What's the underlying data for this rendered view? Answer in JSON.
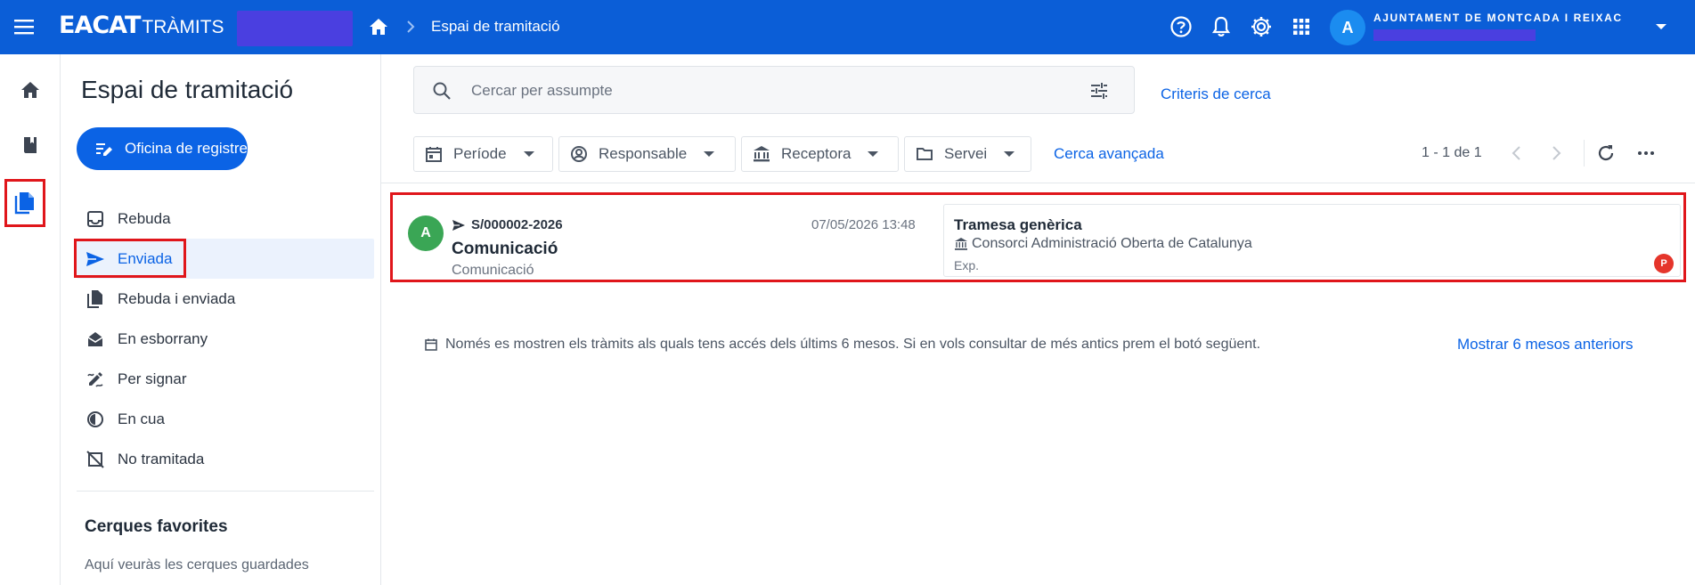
{
  "header": {
    "brand": "EACAT",
    "brand_sub": "TRÀMITS",
    "breadcrumb": "Espai de tramitació",
    "avatar_initial": "A",
    "organization": "AJUNTAMENT DE MONTCADA I REIXAC",
    "icons": [
      "menu-icon",
      "home-icon",
      "help-icon",
      "bell-icon",
      "gear-icon",
      "apps-grid-icon",
      "chevron-down-icon"
    ]
  },
  "rail": {
    "icons": [
      "home-icon",
      "book-icon",
      "documents-icon"
    ]
  },
  "sidebar": {
    "title": "Espai de tramitació",
    "primary_button": "Oficina de registre",
    "items": [
      {
        "label": "Rebuda",
        "icon": "inbox-icon"
      },
      {
        "label": "Enviada",
        "icon": "send-icon"
      },
      {
        "label": "Rebuda i enviada",
        "icon": "copy-icon"
      },
      {
        "label": "En esborrany",
        "icon": "draft-envelope-icon"
      },
      {
        "label": "Per signar",
        "icon": "signature-icon"
      },
      {
        "label": "En cua",
        "icon": "queue-clock-icon"
      },
      {
        "label": "No tramitada",
        "icon": "not-processed-icon"
      }
    ],
    "selected_index": 1,
    "favorites_title": "Cerques favorites",
    "favorites_text": "Aquí veuràs les cerques guardades"
  },
  "search": {
    "placeholder": "Cercar per assumpte",
    "value": "",
    "criteria_link": "Criteris de cerca"
  },
  "filters": [
    {
      "label": "Període",
      "icon": "calendar-icon"
    },
    {
      "label": "Responsable",
      "icon": "user-circle-icon"
    },
    {
      "label": "Receptora",
      "icon": "bank-icon"
    },
    {
      "label": "Servei",
      "icon": "folder-icon"
    }
  ],
  "advanced_link": "Cerca avançada",
  "pagination": {
    "text": "1 - 1 de 1"
  },
  "results": [
    {
      "avatar": "A",
      "reference": "S/000002-2026",
      "date": "07/05/2026 13:48",
      "subject": "Comunicació",
      "type": "Comunicació",
      "procedure": "Tramesa genèrica",
      "organization": "Consorci Administració Oberta de Catalunya",
      "exp_label": "Exp.",
      "badge": "P"
    }
  ],
  "notice": {
    "text": "Només es mostren els tràmits als quals tens accés dels últims 6 mesos. Si en vols consultar de més antics prem el botó següent.",
    "link": "Mostrar 6 mesos anteriors"
  },
  "colors": {
    "topbar": "#0b5ed7",
    "primary": "#0b63e5",
    "highlight": "#e0161b",
    "avatar_green": "#3aa655",
    "badge_red": "#e5352b"
  }
}
